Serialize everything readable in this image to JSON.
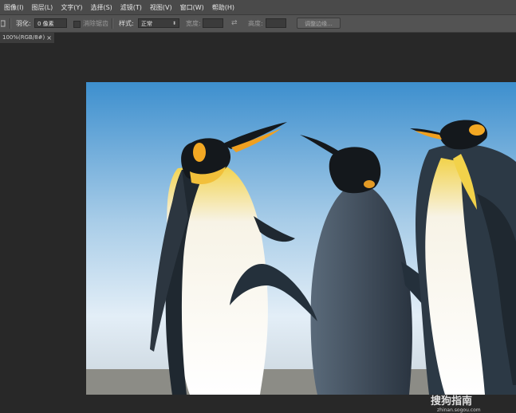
{
  "menu": [
    "图像(I)",
    "图层(L)",
    "文字(Y)",
    "选择(S)",
    "滤镜(T)",
    "视图(V)",
    "窗口(W)",
    "帮助(H)"
  ],
  "options": {
    "feather_label": "羽化:",
    "feather_value": "0 像素",
    "antialias_label": "消除锯齿",
    "style_label": "样式:",
    "style_value": "正常",
    "width_label": "宽度:",
    "height_label": "高度:",
    "refine_edge_button": "调整边缘..."
  },
  "document_tab": {
    "title": "100%(RGB/8#)",
    "close": "×"
  },
  "watermark": {
    "brand": "搜狗指南",
    "url": "zhinan.sogou.com"
  },
  "colors": {
    "menubar": "#4a4a4a",
    "optionsbar": "#535353",
    "workspace": "#282828"
  }
}
